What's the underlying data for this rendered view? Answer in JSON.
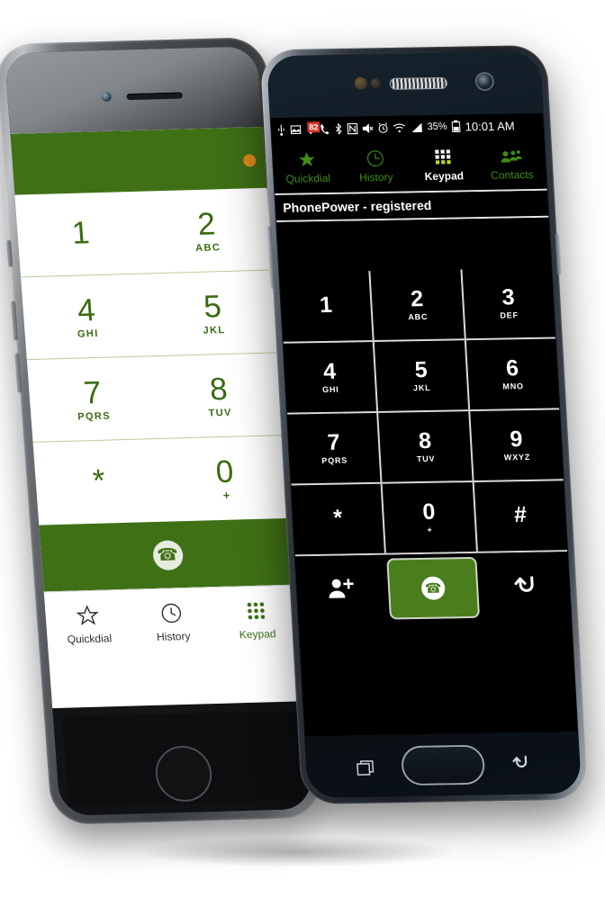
{
  "colors": {
    "brand_green": "#3f7016",
    "android_accent_green": "#3f8c16",
    "call_button_green": "#4a7d1c",
    "badge_red": "#d8342a",
    "keypad_black": "#000000",
    "keypad_white": "#ffffff"
  },
  "iphone": {
    "header": {
      "badge_icon": "orange-dot-icon"
    },
    "keypad": {
      "rows": [
        [
          {
            "digit": "1",
            "sub": ""
          },
          {
            "digit": "2",
            "sub": "ABC"
          }
        ],
        [
          {
            "digit": "4",
            "sub": "GHI"
          },
          {
            "digit": "5",
            "sub": "JKL"
          }
        ],
        [
          {
            "digit": "7",
            "sub": "PQRS"
          },
          {
            "digit": "8",
            "sub": "TUV"
          }
        ],
        [
          {
            "digit": "*",
            "sub": ""
          },
          {
            "digit": "0",
            "sub": "+"
          }
        ]
      ]
    },
    "call_button": {
      "icon": "phone-icon",
      "label": ""
    },
    "tabbar": [
      {
        "label": "Quickdial",
        "icon": "star-outline-icon",
        "active": false
      },
      {
        "label": "History",
        "icon": "clock-icon",
        "active": false
      },
      {
        "label": "Keypad",
        "icon": "grid-dots-icon",
        "active": true
      }
    ]
  },
  "android": {
    "statusbar": {
      "icons": [
        "usb-icon",
        "screenshot-icon",
        "download-icon",
        "call-icon",
        "bluetooth-icon",
        "nfc-icon",
        "mute-icon",
        "alarm-icon",
        "wifi-icon",
        "signal-icon"
      ],
      "download_badge": "82",
      "battery_percent": "35%",
      "battery_icon": "battery-icon",
      "time": "10:01 AM"
    },
    "tabs": [
      {
        "label": "Quickdial",
        "icon": "star-filled-icon",
        "active": false
      },
      {
        "label": "History",
        "icon": "clock-icon",
        "active": false
      },
      {
        "label": "Keypad",
        "icon": "grid-icon",
        "active": true
      },
      {
        "label": "Contacts",
        "icon": "people-icon",
        "active": false
      }
    ],
    "registration_status": "PhonePower - registered",
    "dial_input": {
      "value": "",
      "placeholder": ""
    },
    "keypad": {
      "rows": [
        [
          {
            "digit": "1",
            "sub": ""
          },
          {
            "digit": "2",
            "sub": "ABC"
          },
          {
            "digit": "3",
            "sub": "DEF"
          }
        ],
        [
          {
            "digit": "4",
            "sub": "GHI"
          },
          {
            "digit": "5",
            "sub": "JKL"
          },
          {
            "digit": "6",
            "sub": "MNO"
          }
        ],
        [
          {
            "digit": "7",
            "sub": "PQRS"
          },
          {
            "digit": "8",
            "sub": "TUV"
          },
          {
            "digit": "9",
            "sub": "WXYZ"
          }
        ],
        [
          {
            "digit": "*",
            "sub": ""
          },
          {
            "digit": "0",
            "sub": "+"
          },
          {
            "digit": "#",
            "sub": ""
          }
        ]
      ]
    },
    "actions": [
      {
        "name": "add-contact",
        "icon": "person-add-icon"
      },
      {
        "name": "call",
        "icon": "phone-icon"
      },
      {
        "name": "backspace",
        "icon": "undo-arrow-icon"
      }
    ],
    "navbar": [
      {
        "name": "recents",
        "icon": "recents-icon"
      },
      {
        "name": "home",
        "icon": "home-button-icon"
      },
      {
        "name": "back",
        "icon": "back-arrow-icon"
      }
    ]
  }
}
